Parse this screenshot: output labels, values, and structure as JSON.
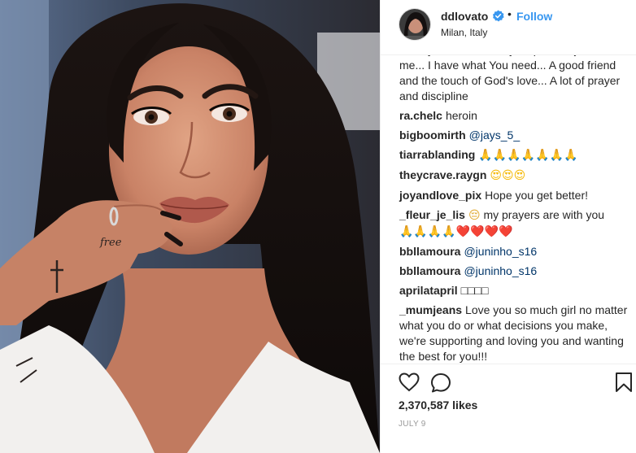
{
  "post": {
    "username": "ddlovato",
    "follow_label": "Follow",
    "location": "Milan, Italy",
    "likes": "2,370,587 likes",
    "date": "JULY 9"
  },
  "comments": [
    {
      "user": "",
      "text": "money... But I can truly help... You just need me... I have what You need... A good friend and the touch of God's love... A lot of prayer and discipline"
    },
    {
      "user": "ra.chelc",
      "text": "heroin"
    },
    {
      "user": "bigboomirth",
      "mention": "@jays_5_"
    },
    {
      "user": "tiarrablanding",
      "emoji": "🙏🙏🙏🙏🙏🙏🙏"
    },
    {
      "user": "theycrave.raygn",
      "emoji": "😍😍😍"
    },
    {
      "user": "joyandlove_pix",
      "text": "Hope you get better!"
    },
    {
      "user": "_fleur_je_lis",
      "emoji_lead": "😔",
      "text": "my prayers are with you",
      "emoji_tail": "🙏🙏🙏🙏❤️❤️❤️❤️"
    },
    {
      "user": "bbllamoura",
      "mention": "@juninho_s16"
    },
    {
      "user": "bbllamoura",
      "mention": "@juninho_s16"
    },
    {
      "user": "aprilatapril",
      "text": "□□□□"
    },
    {
      "user": "_mumjeans",
      "text": "Love you so much girl no matter what you do or what decisions you make, we're supporting and loving you and wanting the best for you!!!"
    }
  ],
  "icons": {
    "verified": "verified-badge-icon",
    "like": "heart-icon",
    "comment": "comment-bubble-icon",
    "save": "bookmark-icon"
  },
  "colors": {
    "link": "#3897f0",
    "mention": "#003569",
    "verified": "#3897f0"
  }
}
